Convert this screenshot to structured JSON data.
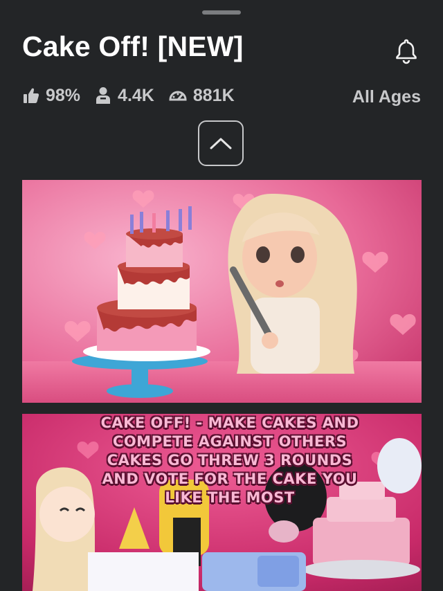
{
  "game": {
    "title": "Cake Off! [NEW]"
  },
  "stats": {
    "like_ratio": "98%",
    "players": "4.4K",
    "visits": "881K",
    "age_rating": "All Ages"
  },
  "icons": {
    "bell": "bell-icon",
    "like": "thumbs-up-icon",
    "players": "person-icon",
    "visits": "speedometer-icon",
    "collapse": "chevron-up-icon"
  },
  "thumbnails": [
    {
      "label": "thumbnail-cake-and-avatar"
    },
    {
      "caption": "CAKE OFF! - MAKE CAKES AND COMPETE AGAINST OTHERS CAKES GO THREW 3 ROUNDS AND VOTE FOR THE CAKE YOU LIKE THE MOST"
    }
  ],
  "colors": {
    "background": "#232527",
    "text_primary": "#ffffff",
    "text_secondary": "#c8c9cb",
    "thumbnail_pink": "#e64f86"
  }
}
